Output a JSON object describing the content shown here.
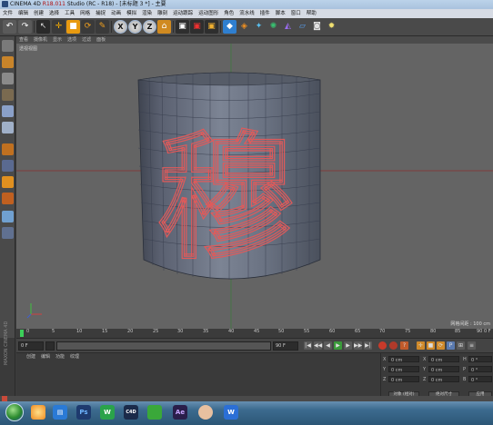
{
  "window": {
    "title_prefix": "CINEMA 4D ",
    "version": "R18.011",
    "title_suffix": " Studio (RC - R18) - [未标题 3 *] - 主要"
  },
  "menu": [
    "文件",
    "编辑",
    "创建",
    "选择",
    "工具",
    "网格",
    "捕捉",
    "动画",
    "模拟",
    "渲染",
    "雕刻",
    "运动跟踪",
    "运动图形",
    "角色",
    "流水线",
    "插件",
    "脚本",
    "窗口",
    "帮助"
  ],
  "toolbar": {
    "axis_x": "X",
    "axis_y": "Y",
    "axis_z": "Z"
  },
  "viewport": {
    "menu": [
      "查看",
      "摄像机",
      "显示",
      "选项",
      "过滤",
      "面板"
    ],
    "label": "透视视图",
    "grid_spacing": "网格间距 : 100 cm",
    "character": "穆"
  },
  "timeline": {
    "ticks": [
      "0",
      "5",
      "10",
      "15",
      "20",
      "25",
      "30",
      "35",
      "40",
      "45",
      "50",
      "55",
      "60",
      "65",
      "70",
      "75",
      "80",
      "85",
      "90"
    ],
    "end_frame": "0 F"
  },
  "transport": {
    "current_frame": "0 F",
    "min_frame": "0 F",
    "max_frame": "90 F"
  },
  "material_panel": {
    "menu": [
      "创建",
      "编辑",
      "功能",
      "纹理"
    ],
    "brand": "MAXON CINEMA 4D"
  },
  "coordinates": {
    "rows": [
      {
        "a_label": "X",
        "a_value": "0 cm",
        "b_label": "X",
        "b_value": "0 cm",
        "c_label": "H",
        "c_value": "0 °"
      },
      {
        "a_label": "Y",
        "a_value": "0 cm",
        "b_label": "Y",
        "b_value": "0 cm",
        "c_label": "P",
        "c_value": "0 °"
      },
      {
        "a_label": "Z",
        "a_value": "0 cm",
        "b_label": "Z",
        "b_value": "0 cm",
        "c_label": "B",
        "c_value": "0 °"
      }
    ],
    "mode_object": "对象 (相对)",
    "mode_size": "绝对尺寸",
    "apply": "应用"
  },
  "taskbar": {
    "apps": [
      {
        "name": "photoshop",
        "label": "Ps",
        "color": "#1e3a6e",
        "fg": "#6fb5ff"
      },
      {
        "name": "wechat",
        "label": "W",
        "color": "#2aa34a",
        "fg": "#ffffff"
      },
      {
        "name": "cinema4d",
        "label": "C4D",
        "color": "#1b2b4a",
        "fg": "#ffffff"
      },
      {
        "name": "after-effects",
        "label": "Ae",
        "color": "#2a1e4a",
        "fg": "#c7a6ff"
      },
      {
        "name": "word",
        "label": "W",
        "color": "#2b6fd6",
        "fg": "#ffffff"
      }
    ]
  }
}
